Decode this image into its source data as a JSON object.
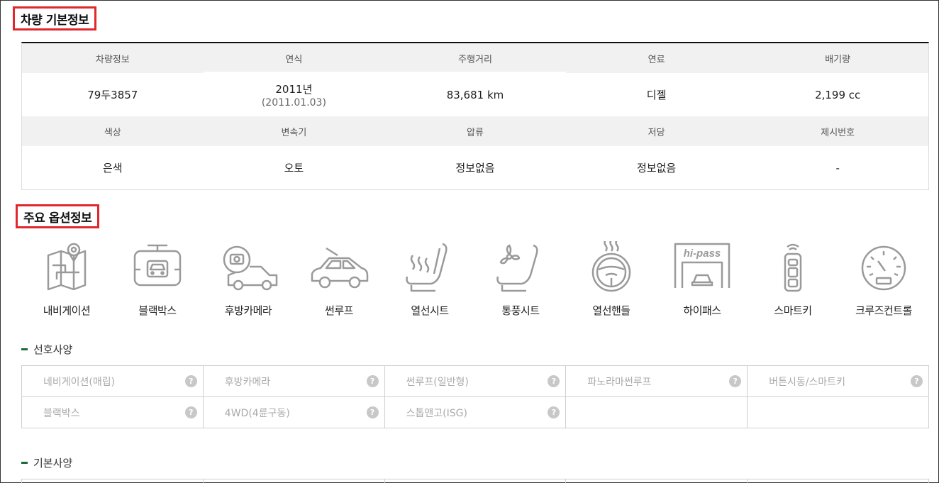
{
  "basic_info": {
    "title": "차량 기본정보",
    "row1_headers": [
      "차량정보",
      "연식",
      "주행거리",
      "연료",
      "배기량"
    ],
    "row1_values": [
      {
        "main": "79두3857",
        "sub": ""
      },
      {
        "main": "2011년",
        "sub": "(2011.01.03)"
      },
      {
        "main": "83,681 km",
        "sub": ""
      },
      {
        "main": "디젤",
        "sub": ""
      },
      {
        "main": "2,199 cc",
        "sub": ""
      }
    ],
    "row2_headers": [
      "색상",
      "변속기",
      "압류",
      "저당",
      "제시번호"
    ],
    "row2_values": [
      "은색",
      "오토",
      "정보없음",
      "정보없음",
      "-"
    ]
  },
  "options": {
    "title": "주요 옵션정보",
    "items": [
      {
        "label": "내비게이션",
        "icon": "navigation-icon"
      },
      {
        "label": "블랙박스",
        "icon": "dashcam-icon"
      },
      {
        "label": "후방카메라",
        "icon": "rear-camera-icon"
      },
      {
        "label": "썬루프",
        "icon": "sunroof-icon"
      },
      {
        "label": "열선시트",
        "icon": "heated-seat-icon"
      },
      {
        "label": "통풍시트",
        "icon": "ventilated-seat-icon"
      },
      {
        "label": "열선핸들",
        "icon": "heated-steering-icon"
      },
      {
        "label": "하이패스",
        "icon": "hipass-icon",
        "icon_text": "hi-pass"
      },
      {
        "label": "스마트키",
        "icon": "smart-key-icon"
      },
      {
        "label": "크루즈컨트롤",
        "icon": "cruise-control-icon"
      }
    ],
    "icon_color": "#9a9a9a"
  },
  "preferred": {
    "title": "선호사양",
    "rows": [
      [
        "네비게이션(매립)",
        "후방카메라",
        "썬루프(일반형)",
        "파노라마썬루프",
        "버튼시동/스마트키"
      ],
      [
        "블랙박스",
        "4WD(4륜구동)",
        "스톱앤고(ISG)",
        "",
        ""
      ]
    ],
    "help_glyph": "?"
  },
  "basic_spec": {
    "title": "기본사양"
  },
  "colors": {
    "title_border": "#e1262c",
    "section_bar": "#1f6b3a",
    "header_bg": "#f1f1f1"
  }
}
